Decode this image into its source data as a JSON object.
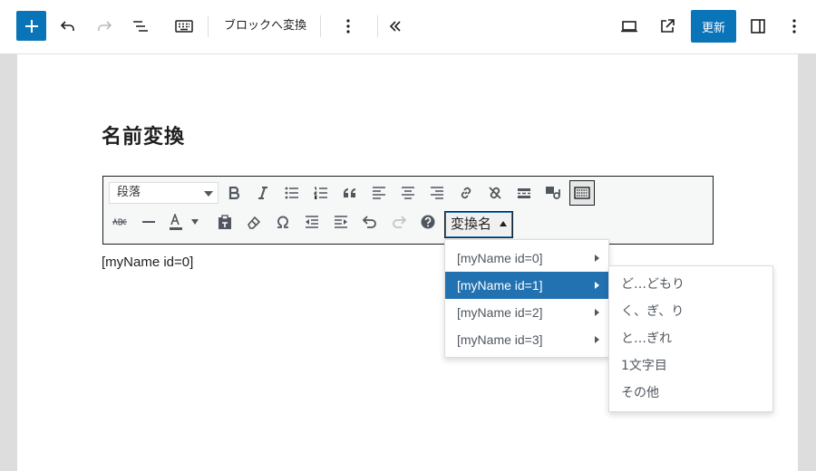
{
  "toolbar": {
    "convert_label": "ブロックへ変換",
    "update_label": "更新"
  },
  "editor": {
    "heading": "名前変換",
    "format_select": "段落",
    "henkan_button": "変換名",
    "body_text": "[myName id=0]"
  },
  "menu": {
    "items": [
      "[myName id=0]",
      "[myName id=1]",
      "[myName id=2]",
      "[myName id=3]"
    ],
    "selected_index": 1
  },
  "submenu": {
    "items": [
      "ど…どもり",
      "く、ぎ、り",
      "と…ぎれ",
      "1文字目",
      "その他"
    ]
  },
  "colors": {
    "accent": "#0a74b8",
    "menu_highlight": "#2271b1"
  }
}
